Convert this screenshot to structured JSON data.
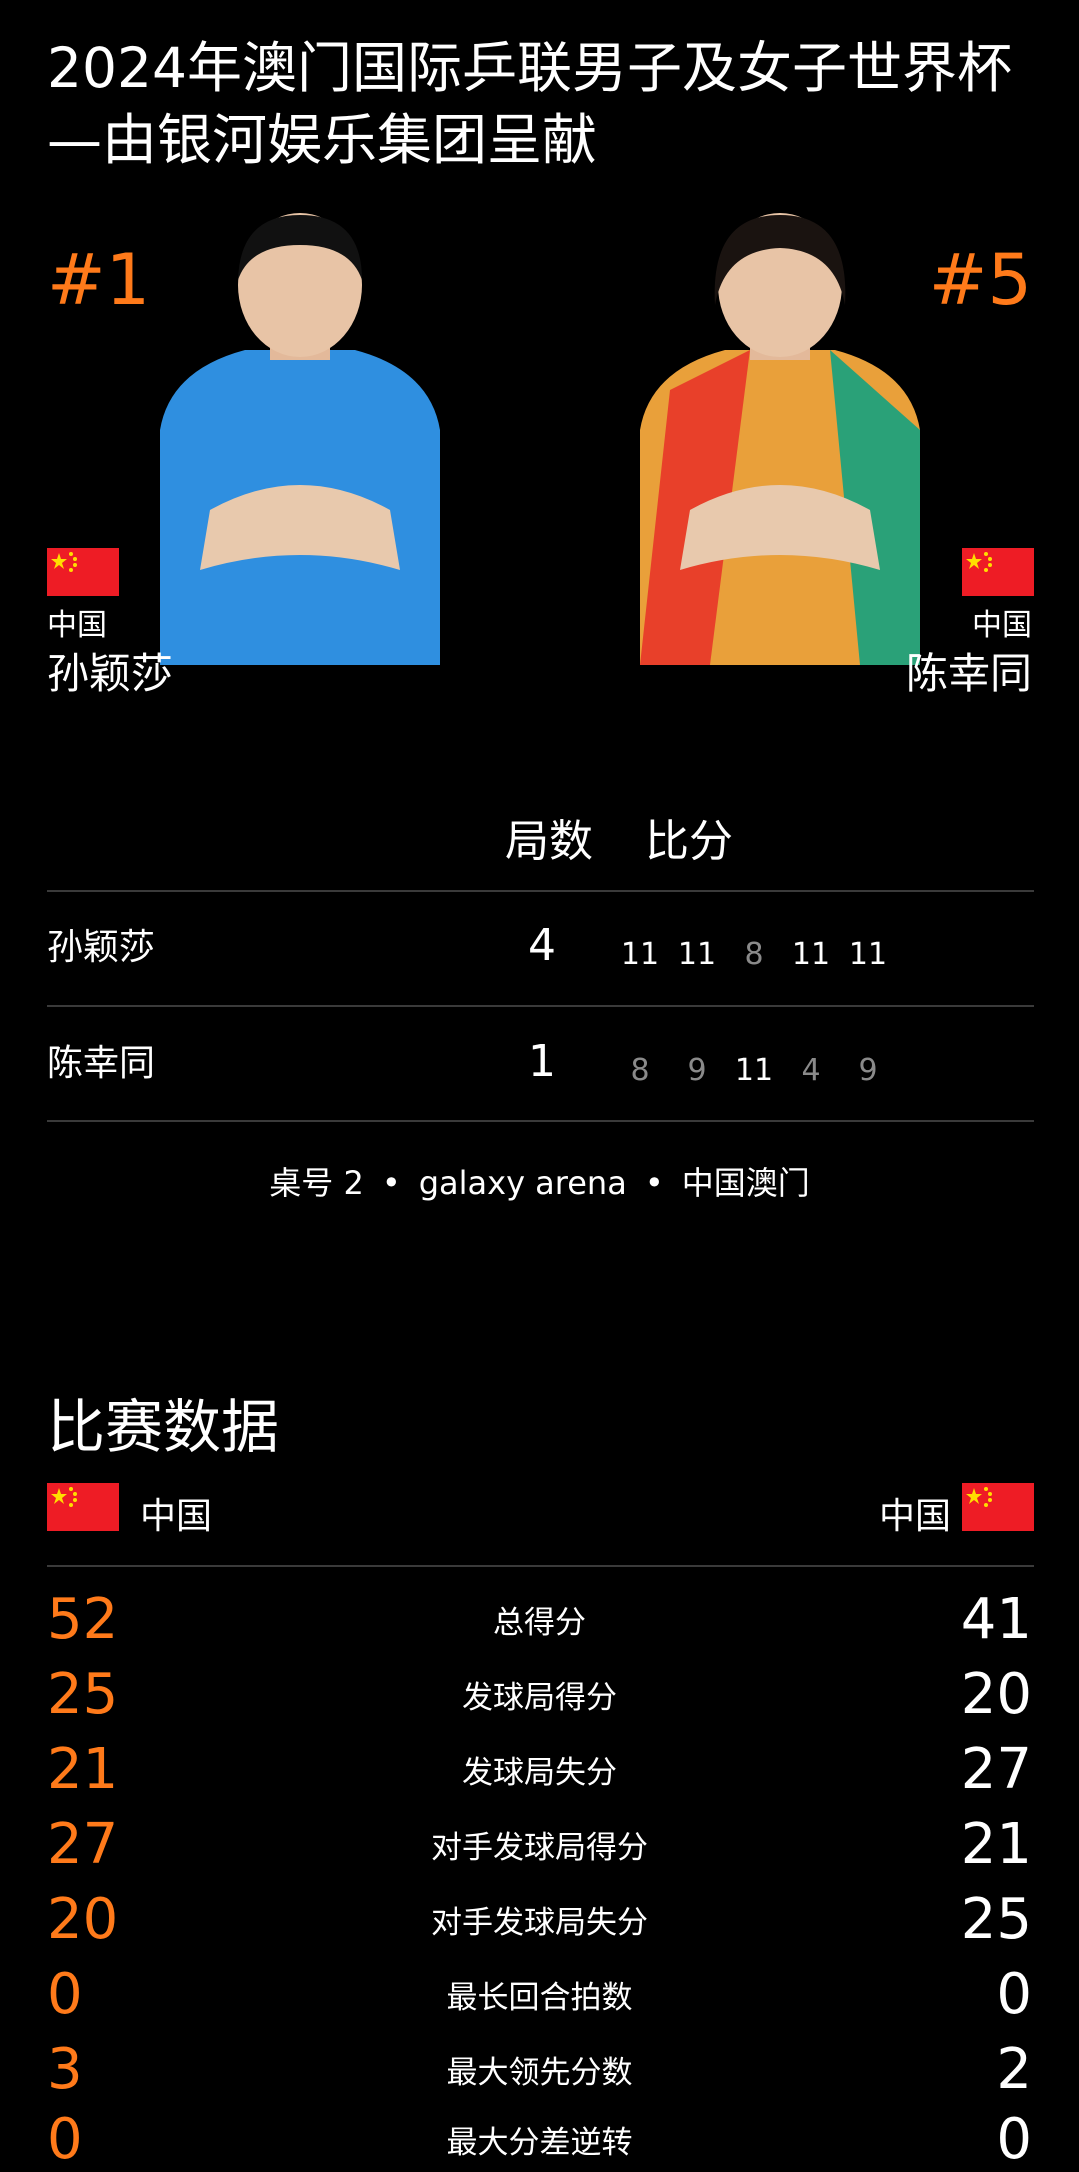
{
  "event_title": "2024年澳门国际乒联男子及女子世界杯—由银河娱乐集团呈献",
  "player1": {
    "rank": "#1",
    "country": "中国",
    "name": "孙颖莎",
    "flag_color": "#ee1c25",
    "photo_jersey_color": "#2f8fe0"
  },
  "player2": {
    "rank": "#5",
    "country": "中国",
    "name": "陈幸同",
    "flag_color": "#ee1c25",
    "photo_jersey_color": "#e9a03a"
  },
  "scoreboard": {
    "games_header": "局数",
    "points_header": "比分",
    "rows": [
      {
        "name": "孙颖莎",
        "games": "4",
        "sets": [
          "11",
          "11",
          "8",
          "11",
          "11"
        ],
        "set_won": [
          true,
          true,
          false,
          true,
          true
        ]
      },
      {
        "name": "陈幸同",
        "games": "1",
        "sets": [
          "8",
          "9",
          "11",
          "4",
          "9"
        ],
        "set_won": [
          false,
          false,
          true,
          false,
          false
        ]
      }
    ]
  },
  "venue": {
    "table": "桌号 2",
    "arena": "galaxy arena",
    "location": "中国澳门",
    "separator": "•"
  },
  "stats": {
    "section_title": "比赛数据",
    "left_country": "中国",
    "right_country": "中国",
    "rows": [
      {
        "label": "总得分",
        "left": "52",
        "right": "41"
      },
      {
        "label": "发球局得分",
        "left": "25",
        "right": "20"
      },
      {
        "label": "发球局失分",
        "left": "21",
        "right": "27"
      },
      {
        "label": "对手发球局得分",
        "left": "27",
        "right": "21"
      },
      {
        "label": "对手发球局失分",
        "left": "20",
        "right": "25"
      },
      {
        "label": "最长回合拍数",
        "left": "0",
        "right": "0"
      },
      {
        "label": "最大领先分数",
        "left": "3",
        "right": "2"
      },
      {
        "label": "最大分差逆转",
        "left": "0",
        "right": "0"
      }
    ]
  },
  "colors": {
    "accent": "#ff7a1a",
    "background": "#000000",
    "divider": "#3a3a3a",
    "lost_set": "#8a8a8a"
  }
}
